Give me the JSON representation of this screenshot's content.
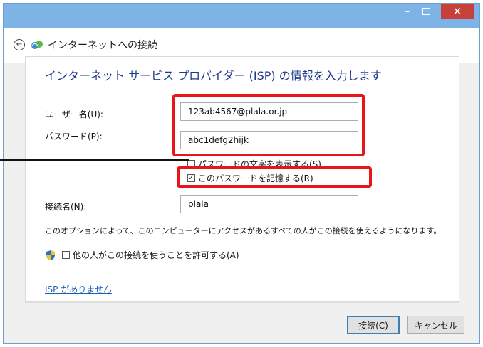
{
  "window": {
    "title_buttons": {
      "minimize": "–",
      "close": "✕"
    }
  },
  "header": {
    "back_glyph": "←",
    "title": "インターネットへの接続"
  },
  "form": {
    "heading": "インターネット サービス プロバイダー (ISP) の情報を入力します",
    "username_label": "ユーザー名(U):",
    "username_value": "123ab4567@plala.or.jp",
    "password_label": "パスワード(P):",
    "password_value": "abc1defg2hijk",
    "show_password_label": "パスワードの文字を表示する(S)",
    "show_password_checked": false,
    "remember_password_label": "このパスワードを記憶する(R)",
    "remember_password_checked": true,
    "remember_check_glyph": "✓",
    "connection_name_label": "接続名(N):",
    "connection_name_value": "plala",
    "info_text": "このオプションによって、このコンピューターにアクセスがあるすべての人がこの接続を使えるようになります。",
    "allow_others_label": "他の人がこの接続を使うことを許可する(A)",
    "allow_others_checked": false,
    "no_isp_link": "ISP がありません"
  },
  "footer": {
    "connect_button": "接続(C)",
    "cancel_button": "キャンセル"
  },
  "colors": {
    "titlebar": "#7eb3e6",
    "close_button": "#c7413a",
    "highlight_red": "#e8151b",
    "heading_blue": "#1f3a8a",
    "link_blue": "#1a5fb4"
  }
}
